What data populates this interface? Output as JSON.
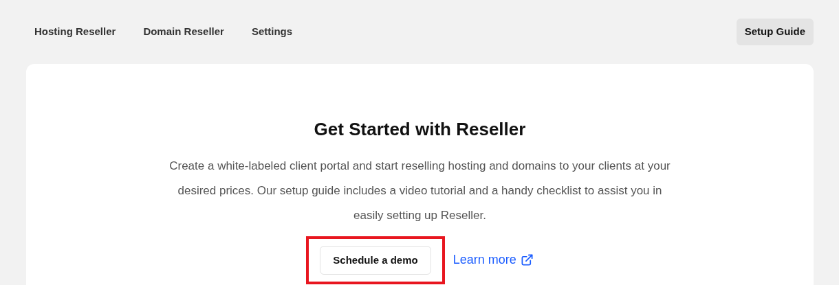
{
  "nav": {
    "tabs": [
      {
        "label": "Hosting Reseller"
      },
      {
        "label": "Domain Reseller"
      },
      {
        "label": "Settings"
      }
    ],
    "setup_button": "Setup Guide"
  },
  "card": {
    "title": "Get Started with Reseller",
    "description": "Create a white-labeled client portal and start reselling hosting and domains to your clients at your desired prices. Our setup guide includes a video tutorial and a handy checklist to assist you in easily setting up Reseller.",
    "demo_button": "Schedule a demo",
    "highlighted": true,
    "learn_more": "Learn more"
  }
}
